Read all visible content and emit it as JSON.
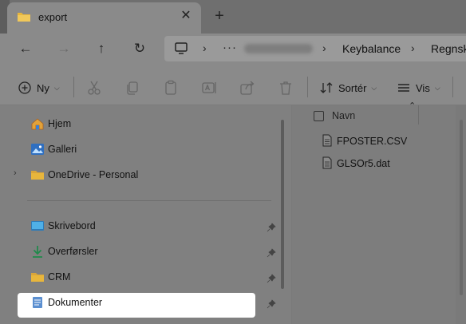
{
  "tab": {
    "title": "export",
    "close": "✕",
    "new_tab": "+"
  },
  "address": {
    "separator": "›",
    "more": "···",
    "crumbs": [
      "Keybalance",
      "Regnsk"
    ]
  },
  "nav_glyphs": {
    "back": "←",
    "forward": "→",
    "up": "↑",
    "refresh": "↻"
  },
  "commands": {
    "new_label": "Ny",
    "sort_label": "Sortér",
    "view_label": "Vis",
    "more": "···"
  },
  "sidebar": {
    "top_items": [
      {
        "label": "Hjem",
        "icon": "home-icon"
      },
      {
        "label": "Galleri",
        "icon": "gallery-icon"
      },
      {
        "label": "OneDrive - Personal",
        "icon": "folder-icon"
      }
    ],
    "quick_access": [
      {
        "label": "Skrivebord",
        "icon": "desktop-icon",
        "pinned": true
      },
      {
        "label": "Overførsler",
        "icon": "download-icon",
        "pinned": true
      },
      {
        "label": "CRM",
        "icon": "folder-icon",
        "pinned": true
      },
      {
        "label": "Dokumenter",
        "icon": "document-icon",
        "pinned": true,
        "selected": true
      }
    ]
  },
  "file_list": {
    "column_name": "Navn",
    "files": [
      {
        "name": "FPOSTER.CSV",
        "icon": "file-icon"
      },
      {
        "name": "GLSOr5.dat",
        "icon": "file-icon"
      }
    ]
  },
  "colors": {
    "accent_folder": "#e8b63c",
    "selected_bg": "#ffffff"
  }
}
